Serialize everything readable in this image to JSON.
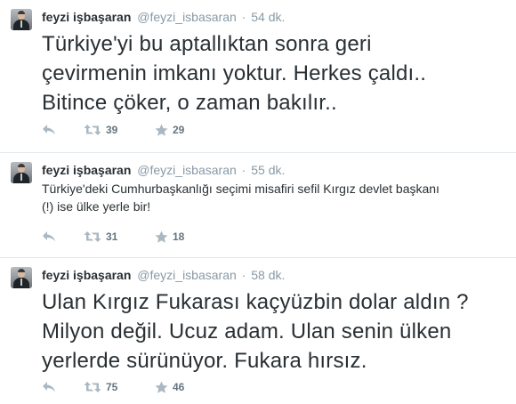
{
  "tweets": [
    {
      "fullname": "feyzi işbaşaran",
      "username": "@feyzi_isbasaran",
      "separator": "·",
      "time": "54 dk.",
      "text_lines": [
        "Türkiye'yi bu aptallıktan sonra geri",
        "çevirmenin imkanı yoktur. Herkes çaldı..",
        "Bitince çöker, o zaman bakılır.."
      ],
      "retweets": "39",
      "favorites": "29"
    },
    {
      "fullname": "feyzi işbaşaran",
      "username": "@feyzi_isbasaran",
      "separator": "·",
      "time": "55 dk.",
      "text_lines": [
        "Türkiye'deki Cumhurbaşkanlığı seçimi misafiri sefil Kırgız devlet başkanı",
        "(!) ise ülke yerle bir!"
      ],
      "retweets": "31",
      "favorites": "18"
    },
    {
      "fullname": "feyzi işbaşaran",
      "username": "@feyzi_isbasaran",
      "separator": "·",
      "time": "58 dk.",
      "text_lines": [
        "Ulan Kırgız Fukarası kaçyüzbin dolar aldın ?",
        "Milyon değil. Ucuz adam. Ulan senin ülken",
        "yerlerde sürünüyor. Fukara hırsız."
      ],
      "retweets": "75",
      "favorites": "46"
    }
  ],
  "icons": {
    "reply": "reply-icon",
    "retweet": "retweet-icon",
    "favorite": "star-icon"
  },
  "colors": {
    "text": "#292f33",
    "meta": "#8899a6",
    "border": "#e1e8ed"
  }
}
